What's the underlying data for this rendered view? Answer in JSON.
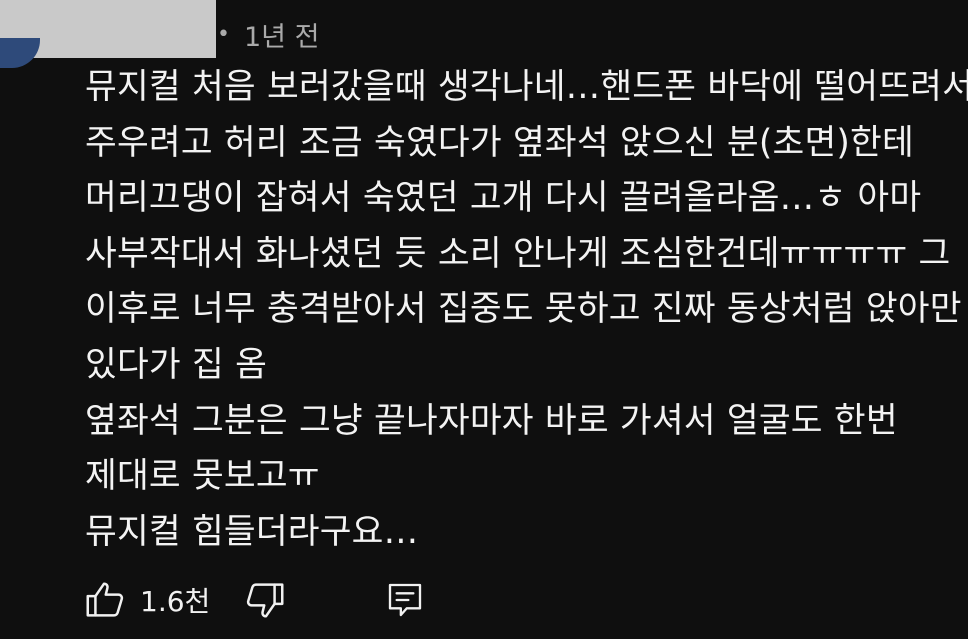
{
  "comment": {
    "timestamp_dot": "•",
    "timestamp": "1년 전",
    "lines": [
      "뮤지컬 처음 보러갔을때 생각나네…핸드폰 바닥에 떨어뜨려서",
      "주우려고 허리 조금 숙였다가 옆좌석 앉으신 분(초면)한테",
      "머리끄댕이 잡혀서 숙였던 고개 다시 끌려올라옴…ㅎ 아마",
      "사부작대서 화나셨던 듯 소리 안나게 조심한건데ㅠㅠㅠㅠ 그",
      "이후로 너무 충격받아서 집중도 못하고 진짜 동상처럼 앉아만",
      "있다가 집 옴",
      "옆좌석 그분은 그냥 끝나자마자 바로 가셔서 얼굴도 한번",
      "제대로 못보고ㅠ",
      "뮤지컬 힘들더라구요…"
    ]
  },
  "actions": {
    "like_icon": "thumbs-up-icon",
    "like_count": "1.6천",
    "dislike_icon": "thumbs-down-icon",
    "reply_icon": "comment-icon"
  },
  "colors": {
    "background": "#0f0f0f",
    "text": "#f1f1f1",
    "meta": "#aaaaaa",
    "redaction": "#c9c9c9"
  }
}
